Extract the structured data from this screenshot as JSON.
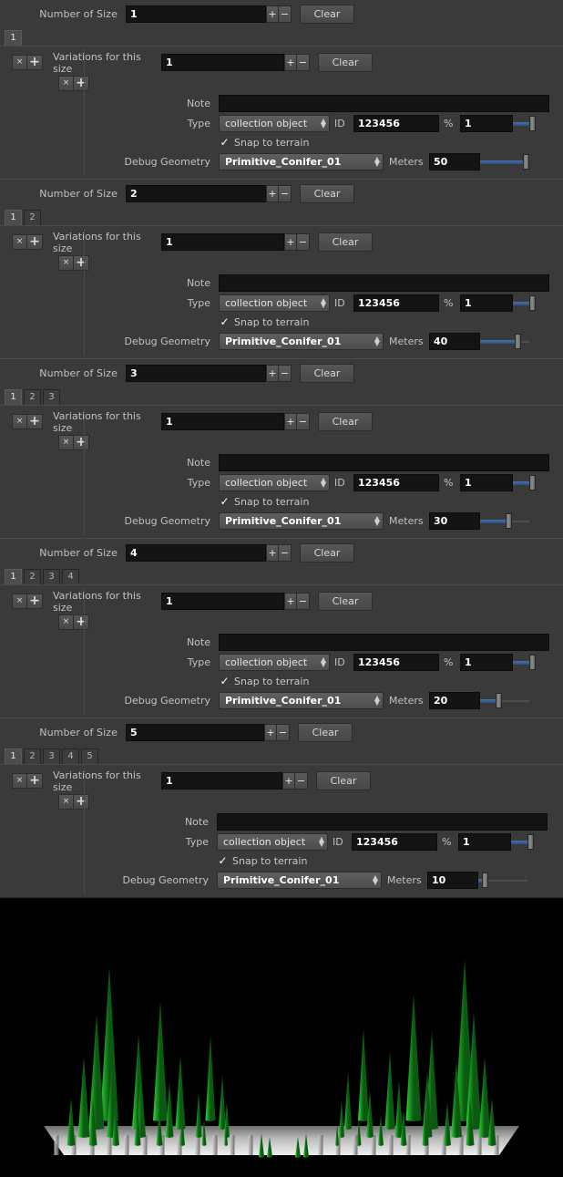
{
  "app": {
    "bg_color": "#3a3a3a",
    "accent_color": "#3a5f96"
  },
  "panels": [
    {
      "size_label": "Number of Size",
      "size_value": "1",
      "plus_label": "+",
      "minus_label": "−",
      "clear_label": "Clear",
      "tabs": [
        "1"
      ],
      "active_tab": 0,
      "remove_label": "×",
      "add_label": "+",
      "variations_label": "Variations for this size",
      "variations_value": "1",
      "variations_clear_label": "Clear",
      "note_label": "Note",
      "note_value": "",
      "type_label": "Type",
      "type_value": "collection object",
      "id_label": "ID",
      "id_value": "123456",
      "percent_label": "%",
      "percent_value": "1",
      "percent_slider": 100,
      "snap_label": "Snap to terrain",
      "snap_checked": true,
      "debug_label": "Debug Geometry",
      "debug_value": "Primitive_Conifer_01",
      "meters_label": "Meters",
      "meters_value": "50",
      "meters_slider": 100
    },
    {
      "size_label": "Number of Size",
      "size_value": "2",
      "plus_label": "+",
      "minus_label": "−",
      "clear_label": "Clear",
      "tabs": [
        "1",
        "2"
      ],
      "active_tab": 0,
      "remove_label": "×",
      "add_label": "+",
      "variations_label": "Variations for this size",
      "variations_value": "1",
      "variations_clear_label": "Clear",
      "note_label": "Note",
      "note_value": "",
      "type_label": "Type",
      "type_value": "collection object",
      "id_label": "ID",
      "id_value": "123456",
      "percent_label": "%",
      "percent_value": "1",
      "percent_slider": 100,
      "snap_label": "Snap to terrain",
      "snap_checked": true,
      "debug_label": "Debug Geometry",
      "debug_value": "Primitive_Conifer_01",
      "meters_label": "Meters",
      "meters_value": "40",
      "meters_slider": 80
    },
    {
      "size_label": "Number of Size",
      "size_value": "3",
      "plus_label": "+",
      "minus_label": "−",
      "clear_label": "Clear",
      "tabs": [
        "1",
        "2",
        "3"
      ],
      "active_tab": 0,
      "remove_label": "×",
      "add_label": "+",
      "variations_label": "Variations for this size",
      "variations_value": "1",
      "variations_clear_label": "Clear",
      "note_label": "Note",
      "note_value": "",
      "type_label": "Type",
      "type_value": "collection object",
      "id_label": "ID",
      "id_value": "123456",
      "percent_label": "%",
      "percent_value": "1",
      "percent_slider": 100,
      "snap_label": "Snap to terrain",
      "snap_checked": true,
      "debug_label": "Debug Geometry",
      "debug_value": "Primitive_Conifer_01",
      "meters_label": "Meters",
      "meters_value": "30",
      "meters_slider": 60
    },
    {
      "size_label": "Number of Size",
      "size_value": "4",
      "plus_label": "+",
      "minus_label": "−",
      "clear_label": "Clear",
      "tabs": [
        "1",
        "2",
        "3",
        "4"
      ],
      "active_tab": 0,
      "remove_label": "×",
      "add_label": "+",
      "variations_label": "Variations for this size",
      "variations_value": "1",
      "variations_clear_label": "Clear",
      "note_label": "Note",
      "note_value": "",
      "type_label": "Type",
      "type_value": "collection object",
      "id_label": "ID",
      "id_value": "123456",
      "percent_label": "%",
      "percent_value": "1",
      "percent_slider": 100,
      "snap_label": "Snap to terrain",
      "snap_checked": true,
      "debug_label": "Debug Geometry",
      "debug_value": "Primitive_Conifer_01",
      "meters_label": "Meters",
      "meters_value": "20",
      "meters_slider": 37
    },
    {
      "size_label": "Number of Size",
      "size_value": "5",
      "plus_label": "+",
      "minus_label": "−",
      "clear_label": "Clear",
      "tabs": [
        "1",
        "2",
        "3",
        "4",
        "5"
      ],
      "active_tab": 0,
      "remove_label": "×",
      "add_label": "+",
      "variations_label": "Variations for this size",
      "variations_value": "1",
      "variations_clear_label": "Clear",
      "note_label": "Note",
      "note_value": "",
      "type_label": "Type",
      "type_value": "collection object",
      "id_label": "ID",
      "id_value": "123456",
      "percent_label": "%",
      "percent_value": "1",
      "percent_slider": 100,
      "snap_label": "Snap to terrain",
      "snap_checked": true,
      "debug_label": "Debug Geometry",
      "debug_value": "Primitive_Conifer_01",
      "meters_label": "Meters",
      "meters_value": "10",
      "meters_slider": 8
    }
  ],
  "viewport": {
    "background_color": "#000000",
    "ground_color": "#d9d9d9",
    "tree_color": "#1f9e26",
    "tree_highlight_color": "#5ed860"
  }
}
